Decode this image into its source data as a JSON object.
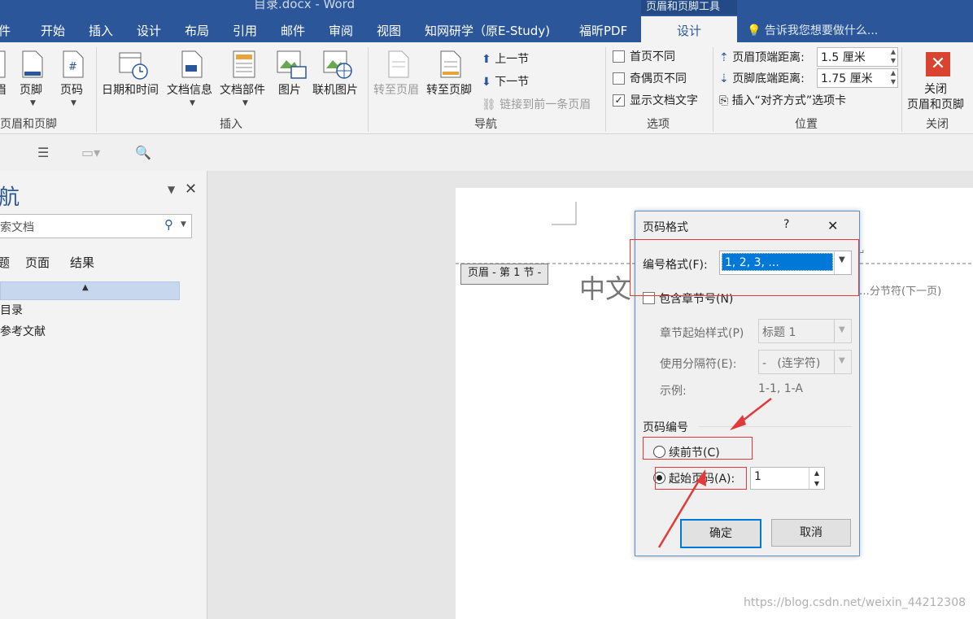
{
  "window": {
    "title": "目录.docx - Word",
    "context_group": "页眉和页脚工具"
  },
  "tabs": [
    "件",
    "开始",
    "插入",
    "设计",
    "布局",
    "引用",
    "邮件",
    "审阅",
    "视图",
    "知网研学（原E-Study)",
    "福昕PDF"
  ],
  "active_tab": "设计",
  "tell_me": "告诉我您想要做什么...",
  "ribbon": {
    "hf_group": {
      "label": "页眉和页脚",
      "items": [
        "眉",
        "页脚",
        "页码"
      ]
    },
    "insert_group": {
      "label": "插入",
      "items": [
        "日期和时间",
        "文档信息",
        "文档部件",
        "图片",
        "联机图片"
      ]
    },
    "nav_group": {
      "label": "导航",
      "goto_header": "转至页眉",
      "goto_footer": "转至页脚",
      "prev": "上一节",
      "next": "下一节",
      "link_prev": "链接到前一条页眉"
    },
    "options_group": {
      "label": "选项",
      "first_diff": "首页不同",
      "odd_even": "奇偶页不同",
      "show_doc": "显示文档文字"
    },
    "position_group": {
      "label": "位置",
      "header_top": "页眉顶端距离:",
      "header_top_val": "1.5 厘米",
      "footer_bottom": "页脚底端距离:",
      "footer_bottom_val": "1.75 厘米",
      "insert_align": "插入“对齐方式”选项卡"
    },
    "close_group": {
      "label": "关闭",
      "close_line1": "关闭",
      "close_line2": "页眉和页脚"
    }
  },
  "nav_pane": {
    "title": "航",
    "search_placeholder": "索文档",
    "tabs": [
      "题",
      "页面",
      "结果"
    ],
    "items": [
      "目录",
      "参考文献"
    ]
  },
  "document": {
    "header_tag": "页眉 - 第 1 节 -",
    "big_text": "中文",
    "section_break": "分节符(下一页)"
  },
  "dialog": {
    "title": "页码格式",
    "help": "?",
    "close": "✕",
    "number_format_label": "编号格式(F):",
    "number_format_value": "1, 2, 3, ...",
    "include_chapter": "包含章节号(N)",
    "chapter_style_label": "章节起始样式(P)",
    "chapter_style_value": "标题 1",
    "separator_label": "使用分隔符(E):",
    "separator_value": "-   (连字符)",
    "example_label": "示例:",
    "example_value": "1-1, 1-A",
    "page_numbering": "页码编号",
    "continue_prev": "续前节(C)",
    "start_at": "起始页码(A):",
    "start_value": "1",
    "ok": "确定",
    "cancel": "取消"
  },
  "watermark": "https://blog.csdn.net/weixin_44212308",
  "colors": {
    "brand": "#2b579a",
    "annotation": "#e23a3a",
    "selection": "#0078d7"
  }
}
